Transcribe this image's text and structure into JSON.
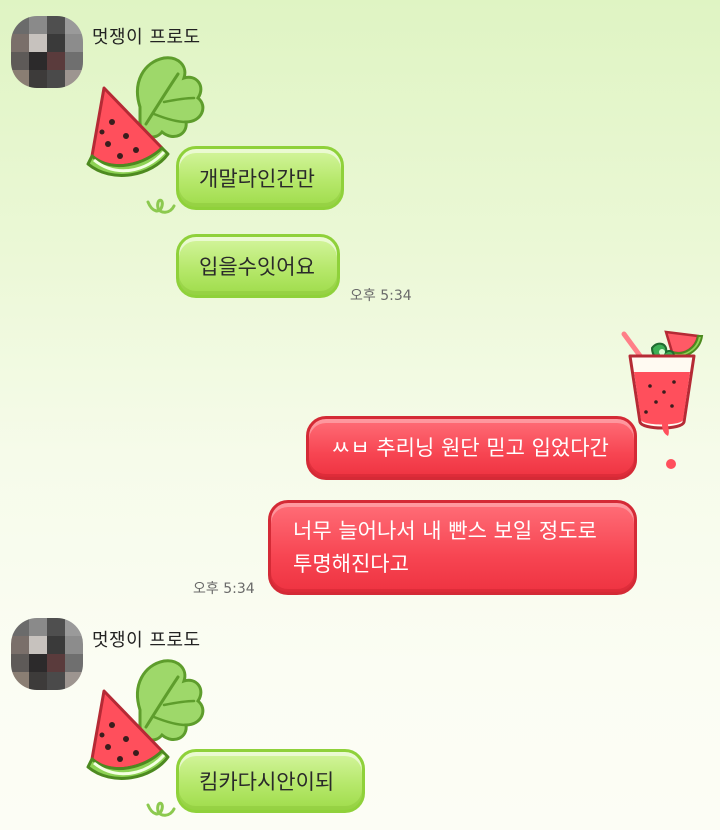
{
  "chat": {
    "messages": [
      {
        "sender": "멋쟁이 프로도",
        "text": "개말라인간만"
      },
      {
        "text": "입을수잇어요",
        "time": "오후 5:34"
      },
      {
        "text": "ㅆㅂ 추리닝 원단 믿고 입었다간"
      },
      {
        "line1": "너무 늘어나서 내 빤스 보일 정도로",
        "line2": "투명해진다고",
        "time": "오후 5:34"
      },
      {
        "sender": "멋쟁이 프로도",
        "text": "킴카다시안이되"
      }
    ]
  },
  "colors": {
    "accent_green": "#b6e86b",
    "accent_red": "#f74552",
    "background": "#e6f6cf"
  },
  "icons": [
    "watermelon-slice-sticker",
    "watermelon-juice-sticker",
    "avatar-pixelated"
  ]
}
